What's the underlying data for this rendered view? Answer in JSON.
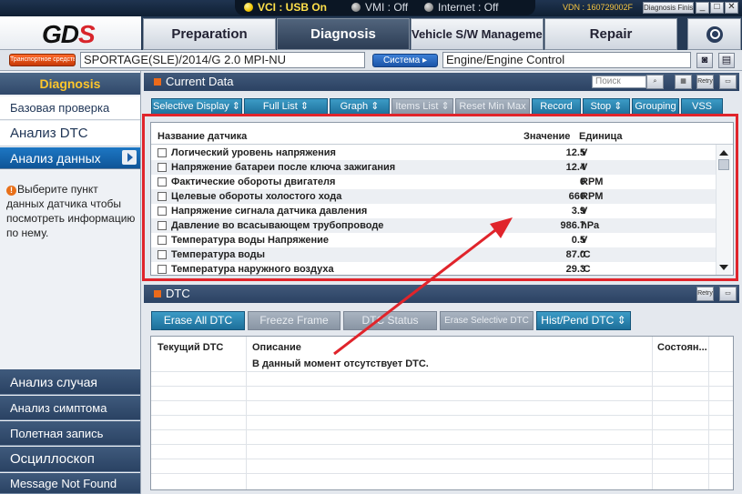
{
  "titlebar": {
    "vci": "VCI : USB On",
    "vmi": "VMI : Off",
    "internet": "Internet : Off",
    "vdn": "VDN : 160729002F",
    "diagnosis_finish": "Diagnosis Finish",
    "minimize": "_",
    "maximize": "□",
    "close": "✕"
  },
  "logo": {
    "text_main": "GD",
    "text_accent": "S"
  },
  "tabs": {
    "preparation": "Preparation",
    "diagnosis": "Diagnosis",
    "vehicle_sw": "Vehicle S/W Management",
    "repair": "Repair"
  },
  "vehicle": {
    "vehicle_button": "Транспортное средство",
    "model": "SPORTAGE(SLE)/2014/G 2.0 MPI-NU",
    "system_button": "Система ▸",
    "system": "Engine/Engine Control"
  },
  "sidebar": {
    "header": "Diagnosis",
    "top_items": [
      {
        "label": "Базовая проверка"
      },
      {
        "label": "Анализ DTC"
      },
      {
        "label": "Анализ данных"
      }
    ],
    "info_icon": "!",
    "info": "Выберите пункт данных датчика чтобы посмотреть информацию по нему.",
    "bottom_items": [
      {
        "label": "Анализ случая"
      },
      {
        "label": "Анализ симптома"
      },
      {
        "label": "Полетная запись"
      },
      {
        "label": "Осциллоскоп"
      },
      {
        "label": "Message Not Found"
      }
    ]
  },
  "current_data": {
    "title": "Current Data",
    "search_placeholder": "Поиск",
    "retry_label": "Retry",
    "toolbar": [
      {
        "label": "Selective Display ⇕",
        "enabled": true
      },
      {
        "label": "Full List ⇕",
        "enabled": true
      },
      {
        "label": "Graph ⇕",
        "enabled": true
      },
      {
        "label": "Items List ⇕",
        "enabled": false
      },
      {
        "label": "Reset Min Max",
        "enabled": false
      },
      {
        "label": "Record",
        "enabled": true
      },
      {
        "label": "Stop ⇕",
        "enabled": true
      },
      {
        "label": "Grouping",
        "enabled": true
      },
      {
        "label": "VSS",
        "enabled": true
      }
    ],
    "columns": {
      "name": "Название датчика",
      "value": "Значение",
      "unit": "Единица"
    },
    "rows": [
      {
        "name": "Логический уровень напряжения",
        "value": "12.5",
        "unit": "V"
      },
      {
        "name": "Напряжение батареи после ключа зажигания",
        "value": "12.4",
        "unit": "V"
      },
      {
        "name": "Фактические обороты двигателя",
        "value": "0",
        "unit": "RPM"
      },
      {
        "name": "Целевые обороты холостого хода",
        "value": "660",
        "unit": "RPM"
      },
      {
        "name": "Напряжение сигнала датчика давления",
        "value": "3.9",
        "unit": "V"
      },
      {
        "name": "Давление во всасывающем трубопроводе",
        "value": "986.7",
        "unit": "hPa"
      },
      {
        "name": "Температура воды Напряжение",
        "value": "0.5",
        "unit": "V"
      },
      {
        "name": "Температура воды",
        "value": "87.0",
        "unit": "'C"
      },
      {
        "name": "Температура наружного воздуха",
        "value": "29.3",
        "unit": "'C"
      }
    ]
  },
  "dtc": {
    "title": "DTC",
    "retry_label": "Retry",
    "toolbar": [
      {
        "label": "Erase All DTC",
        "enabled": true
      },
      {
        "label": "Freeze Frame",
        "enabled": false
      },
      {
        "label": "DTC Status",
        "enabled": false
      },
      {
        "label": "Erase Selective DTC",
        "enabled": false
      },
      {
        "label": "Hist/Pend DTC ⇕",
        "enabled": true
      }
    ],
    "columns": {
      "code": "Текущий DTC",
      "description": "Описание",
      "state": "Состоян..."
    },
    "message": "В данный момент отсутствует DTC."
  },
  "colors": {
    "highlight_frame": "#e0242b",
    "annotation_arrow": "#e0242b",
    "header_bg": "#2b4263",
    "button_blue": "#1d6f9a",
    "logo_accent": "#d8252b"
  }
}
